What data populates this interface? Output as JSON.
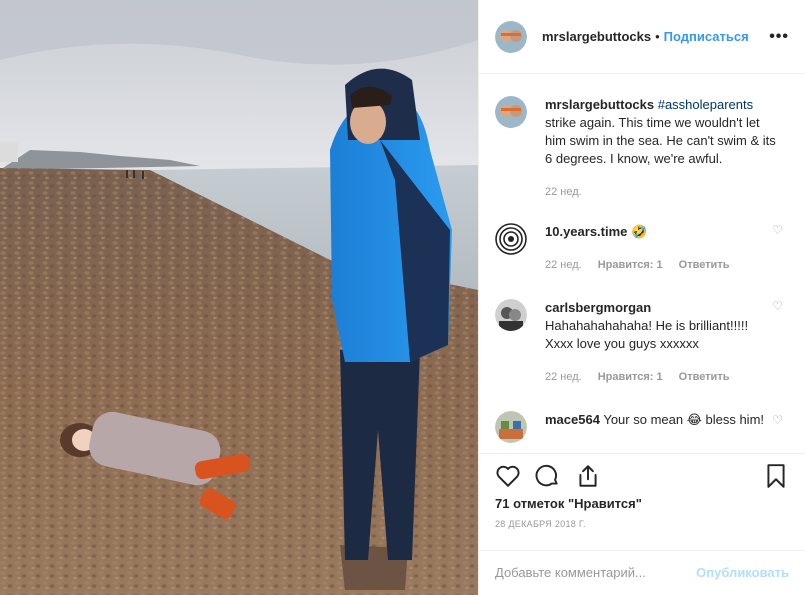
{
  "header": {
    "username": "mrslargebuttocks",
    "separator": "•",
    "follow_label": "Подписаться",
    "more_icon": "more-horizontal-icon",
    "more_label": "•••"
  },
  "caption": {
    "username": "mrslargebuttocks",
    "hashtag": "#assholeparents",
    "text": "strike again. This time we wouldn't let him swim in the sea. He can't swim & its 6 degrees. I know, we're awful.",
    "time": "22 нед."
  },
  "comments": [
    {
      "username": "10.years.time",
      "text": "🤣",
      "time": "22 нед.",
      "likes": "Нравится: 1",
      "reply": "Ответить"
    },
    {
      "username": "carlsbergmorgan",
      "text": "Hahahahahahaha! He is brilliant!!!!! Xxxx love you guys xxxxxx",
      "time": "22 нед.",
      "likes": "Нравится: 1",
      "reply": "Ответить"
    },
    {
      "username": "mace564",
      "text": "Your so mean 😂 bless him!"
    }
  ],
  "actions": {
    "likes_text": "71 отметок \"Нравится\"",
    "date": "28 ДЕКАБРЯ 2018 Г."
  },
  "add_comment": {
    "placeholder": "Добавьте комментарий...",
    "post_label": "Опубликовать"
  },
  "colors": {
    "link": "#3897f0",
    "hashtag": "#003569",
    "muted": "#999999",
    "post_disabled": "#b2dffc"
  }
}
